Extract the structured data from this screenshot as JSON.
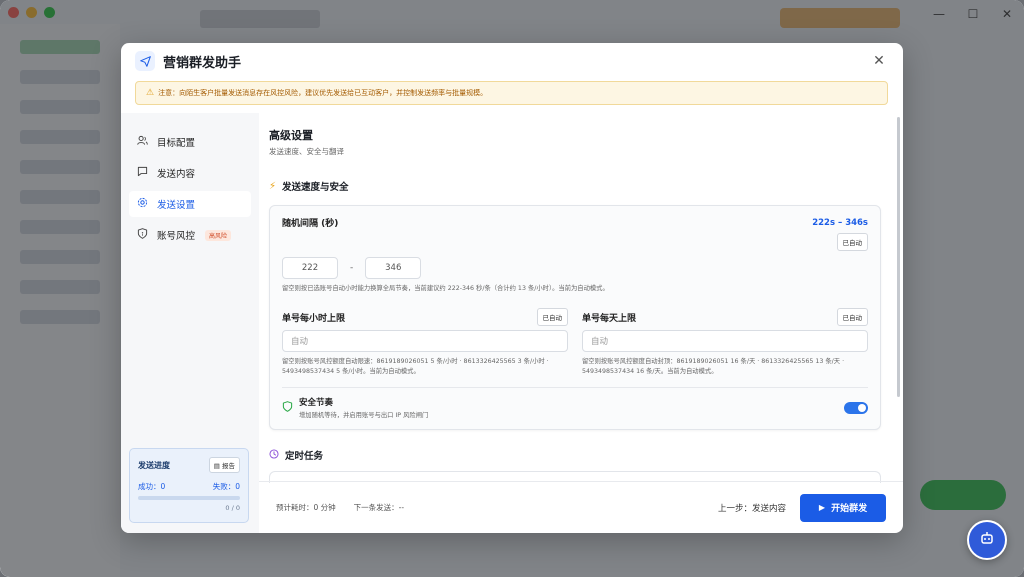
{
  "window": {
    "controls": {
      "minimize": "—",
      "maximize": "☐",
      "close": "✕"
    }
  },
  "modal": {
    "title": "营销群发助手",
    "close_icon": "✕",
    "warning": "注意：向陌生客户批量发送消息存在风控风险，建议优先发送给已互动客户，并控制发送频率与批量规模。"
  },
  "nav": {
    "items": [
      {
        "label": "目标配置",
        "icon": "users-icon",
        "active": false
      },
      {
        "label": "发送内容",
        "icon": "message-icon",
        "active": false
      },
      {
        "label": "发送设置",
        "icon": "gear-icon",
        "active": true
      },
      {
        "label": "账号风控",
        "icon": "shield-icon",
        "active": false,
        "badge": "高风险"
      }
    ]
  },
  "progress": {
    "title": "发送进度",
    "report_label": "报告",
    "success_label": "成功：0",
    "fail_label": "失败：0",
    "count": "0 / 0",
    "percent": 0
  },
  "settings": {
    "title": "高级设置",
    "subtitle": "发送速度、安全与翻译",
    "speed_group": "发送速度与安全",
    "interval": {
      "label": "随机间隔 (秒)",
      "range_text": "222s – 346s",
      "auto_label": "已自动",
      "min": "222",
      "max": "346",
      "hint": "留空则按已选账号自动小时能力换算全局节奏，当前建议约 222-346 秒/条（合计约 13 条/小时）。当前为自动模式。"
    },
    "hourly": {
      "label": "单号每小时上限",
      "auto_label": "已自动",
      "placeholder": "自动",
      "hint": "留空则按账号风控额度自动限速：8619189026051 5 条/小时 · 8613326425565 3 条/小时 · 5493498537434 5 条/小时。当前为自动模式。"
    },
    "daily": {
      "label": "单号每天上限",
      "auto_label": "已自动",
      "placeholder": "自动",
      "hint": "留空则按账号风控额度自动封顶：8619189026051 16 条/天 · 8613326425565 13 条/天 · 5493498537434 16 条/天。当前为自动模式。"
    },
    "safe": {
      "title": "安全节奏",
      "subtitle": "增加随机等待，并启用账号与出口 IP 风险闸门",
      "enabled": true
    },
    "schedule_group": "定时任务"
  },
  "footer": {
    "eta": "预计耗时：0 分钟",
    "next_send": "下一条发送：--",
    "prev_label": "上一步：发送内容",
    "start_label": "开始群发"
  },
  "colors": {
    "accent": "#1b5ce6",
    "warning_bg": "#fdf6e3",
    "warning_text": "#a35a00",
    "toggle_on": "#2b74ea",
    "bot_bg": "#2f5bd9"
  }
}
